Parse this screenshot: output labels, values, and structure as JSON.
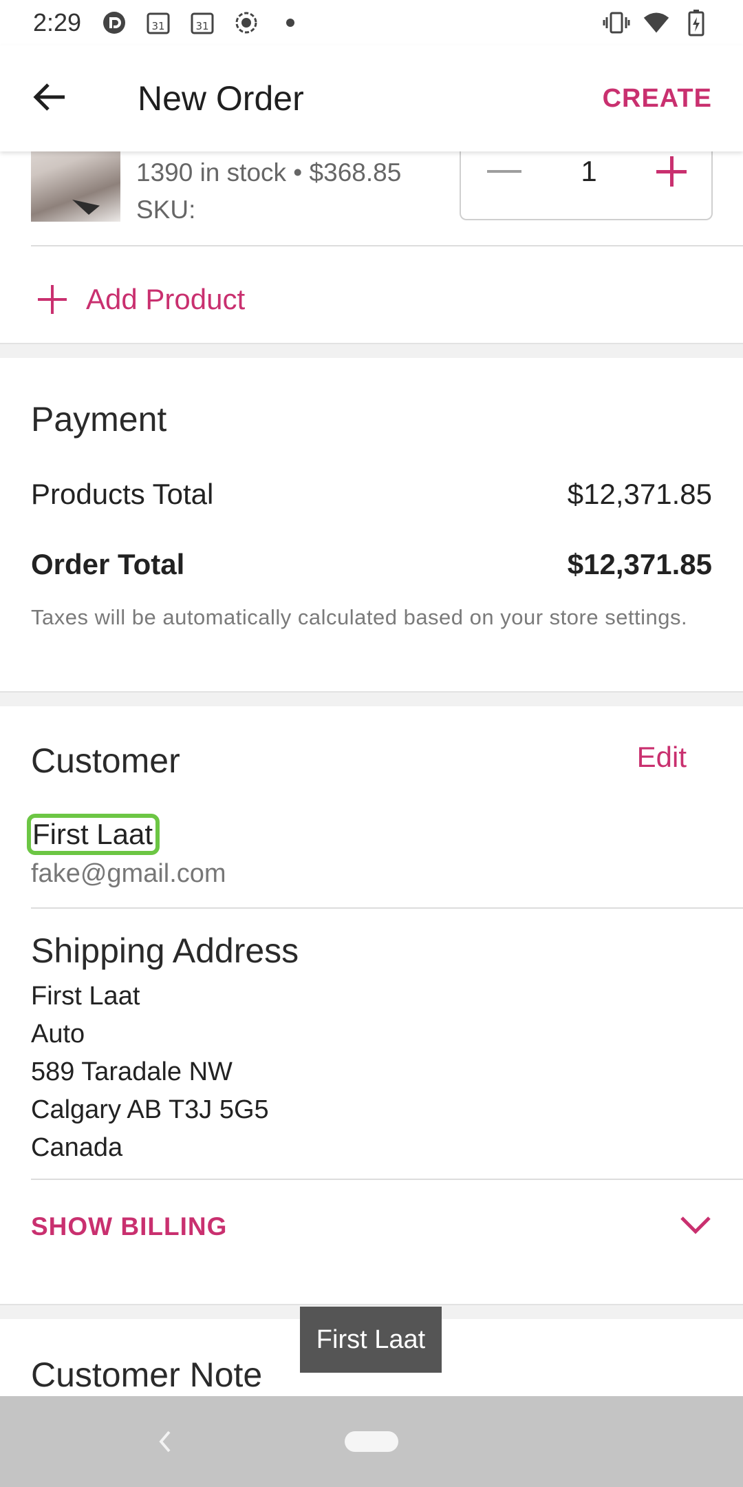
{
  "status_bar": {
    "time": "2:29",
    "icons_left": [
      "pocket-casts-icon",
      "calendar-icon",
      "calendar-icon",
      "screen-record-icon",
      "dot-icon"
    ],
    "calendar_day": "31",
    "icons_right": [
      "vibrate-icon",
      "wifi-icon",
      "battery-charging-icon"
    ]
  },
  "app_bar": {
    "title": "New Order",
    "create_label": "CREATE"
  },
  "product": {
    "stock_price": "1390 in stock • $368.85",
    "sku_label": "SKU:",
    "quantity": "1"
  },
  "add_product_label": "Add Product",
  "payment": {
    "title": "Payment",
    "products_total_label": "Products Total",
    "products_total_value": "$12,371.85",
    "order_total_label": "Order Total",
    "order_total_value": "$12,371.85",
    "tax_note": "Taxes will be automatically calculated based on your store settings."
  },
  "customer": {
    "title": "Customer",
    "edit_label": "Edit",
    "name": "First Laat",
    "email": "fake@gmail.com"
  },
  "shipping": {
    "title": "Shipping Address",
    "lines": [
      "First Laat",
      "Auto",
      "589 Taradale NW",
      "Calgary AB T3J 5G5",
      "Canada"
    ]
  },
  "show_billing_label": "SHOW BILLING",
  "customer_note_title": "Customer Note",
  "toast_text": "First Laat",
  "colors": {
    "accent": "#c9306f",
    "highlight": "#6cc644"
  }
}
